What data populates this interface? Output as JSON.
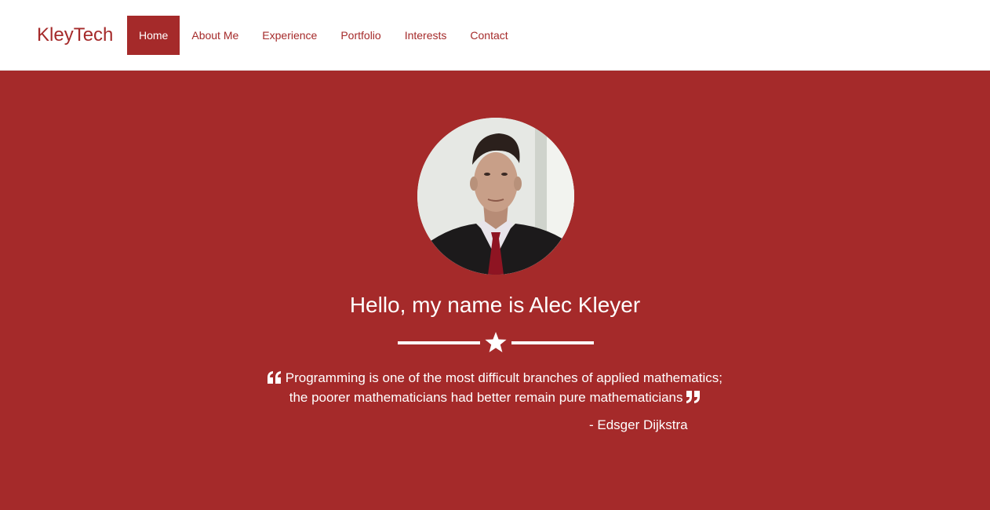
{
  "navbar": {
    "brand": "KleyTech",
    "items": [
      {
        "label": "Home",
        "active": true
      },
      {
        "label": "About Me",
        "active": false
      },
      {
        "label": "Experience",
        "active": false
      },
      {
        "label": "Portfolio",
        "active": false
      },
      {
        "label": "Interests",
        "active": false
      },
      {
        "label": "Contact",
        "active": false
      }
    ]
  },
  "hero": {
    "avatar_icon": "profile-photo",
    "headline": "Hello, my name is Alec Kleyer",
    "divider_icon": "star-icon",
    "quote_line_1": "Programming is one of the most difficult branches of applied mathematics;",
    "quote_line_2": "the poorer mathematicians had better remain pure mathematicians",
    "quote_open_icon": "quote-left-icon",
    "quote_close_icon": "quote-right-icon",
    "author": "- Edsger Dijkstra"
  },
  "colors": {
    "brand": "#a52a2a",
    "navbar_bg": "#ffffff",
    "text_on_brand": "#ffffff"
  }
}
